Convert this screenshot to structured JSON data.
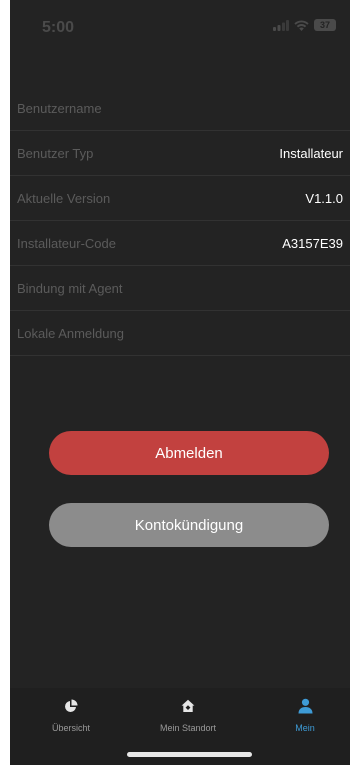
{
  "status_bar": {
    "time": "5:00",
    "battery": "37"
  },
  "account_info": [
    {
      "label": "Benutzername",
      "value": ""
    },
    {
      "label": "Benutzer Typ",
      "value": "Installateur"
    },
    {
      "label": "Aktuelle Version",
      "value": "V1.1.0"
    },
    {
      "label": "Installateur-Code",
      "value": "A3157E39"
    },
    {
      "label": "Bindung mit Agent",
      "value": ""
    },
    {
      "label": "Lokale Anmeldung",
      "value": ""
    }
  ],
  "actions": {
    "logout_label": "Abmelden",
    "cancel_account_label": "Kontokündigung"
  },
  "tabs": [
    {
      "label": "Übersicht",
      "icon": "pie-chart-icon",
      "active": false
    },
    {
      "label": "Mein Standort",
      "icon": "home-icon",
      "active": false
    },
    {
      "label": "Mein",
      "icon": "person-icon",
      "active": true
    }
  ],
  "colors": {
    "background": "#232323",
    "logout_button": "#c2413f",
    "cancel_button": "#8c8c8c",
    "active_tab": "#3e9bd6"
  }
}
